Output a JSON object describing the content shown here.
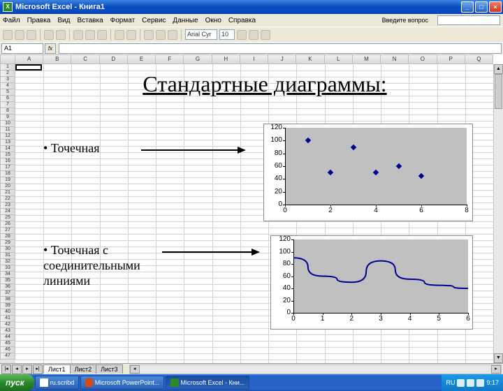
{
  "window": {
    "title": "Microsoft Excel - Книга1",
    "app_icon": "X"
  },
  "menu": {
    "file": "Файл",
    "edit": "Правка",
    "view": "Вид",
    "insert": "Вставка",
    "format": "Формат",
    "tools": "Сервис",
    "data": "Данные",
    "window": "Окно",
    "help": "Справка",
    "ask_label": "Введите вопрос"
  },
  "toolbar": {
    "font_name": "Arial Cyr",
    "font_size": "10"
  },
  "formula_bar": {
    "name_box": "A1",
    "fx": "fx"
  },
  "columns": [
    "A",
    "B",
    "C",
    "D",
    "E",
    "F",
    "G",
    "H",
    "I",
    "J",
    "K",
    "L",
    "M",
    "N",
    "O",
    "P",
    "Q"
  ],
  "content": {
    "title": "Стандартные диаграммы:",
    "bullet1": "Точечная",
    "bullet2_line1": "Точечная с",
    "bullet2_line2": "соединительными",
    "bullet2_line3": "линиями"
  },
  "chart_data": [
    {
      "type": "scatter",
      "x": [
        1,
        2,
        3,
        4,
        5,
        6
      ],
      "y": [
        100,
        50,
        90,
        50,
        60,
        45
      ],
      "xlim": [
        0,
        8
      ],
      "ylim": [
        0,
        120
      ],
      "xticks": [
        0,
        2,
        4,
        6,
        8
      ],
      "yticks": [
        0,
        20,
        40,
        60,
        80,
        100,
        120
      ]
    },
    {
      "type": "line",
      "x": [
        0,
        1,
        2,
        3,
        4,
        5,
        6
      ],
      "y": [
        90,
        60,
        50,
        85,
        55,
        45,
        40
      ],
      "xlim": [
        0,
        6
      ],
      "ylim": [
        0,
        120
      ],
      "xticks": [
        0,
        1,
        2,
        3,
        4,
        5,
        6
      ],
      "yticks": [
        0,
        20,
        40,
        60,
        80,
        100,
        120
      ]
    }
  ],
  "sheets": {
    "active": "Лист1",
    "t2": "Лист2",
    "t3": "Лист3"
  },
  "taskbar": {
    "start": "пуск",
    "item1": "ru.scribd",
    "item2": "Microsoft PowerPoint...",
    "item3": "Microsoft Excel - Кни...",
    "time": "9:17",
    "lang": "RU"
  }
}
